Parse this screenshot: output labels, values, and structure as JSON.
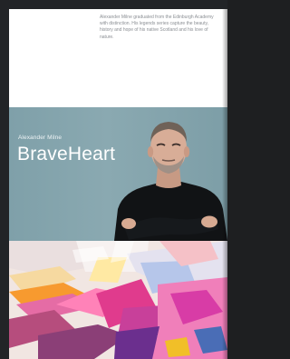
{
  "book": {
    "bio": "Alexander Milne graduated from the Edinburgh Academy with distinction. His legends series capture the beauty, history and hope of his native Scotland and his love of nature.",
    "author": "Alexander Milne",
    "title": "BraveHeart"
  },
  "colors": {
    "hero_bg": "#86a6ae",
    "page_bg": "#ffffff",
    "device_frame": "#222427"
  }
}
